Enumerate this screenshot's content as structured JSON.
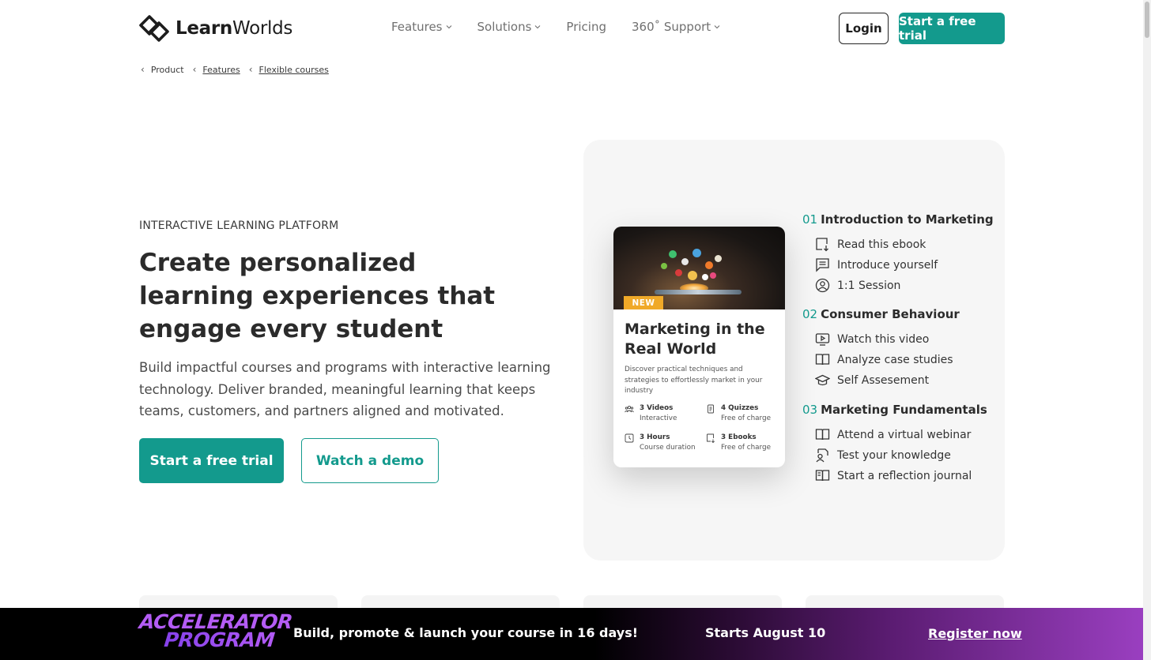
{
  "header": {
    "logo_bold": "Learn",
    "logo_regular": "Worlds",
    "nav": [
      {
        "label": "Features",
        "has_dropdown": true
      },
      {
        "label": "Solutions",
        "has_dropdown": true
      },
      {
        "label": "Pricing",
        "has_dropdown": false
      },
      {
        "label": "360˚ Support",
        "has_dropdown": true
      }
    ],
    "login_label": "Login",
    "trial_label": "Start a free trial"
  },
  "breadcrumb": [
    "Product",
    "Features",
    "Flexible courses"
  ],
  "hero": {
    "eyebrow": "INTERACTIVE LEARNING PLATFORM",
    "title": "Create personalized learning experiences that engage every student",
    "description": "Build impactful courses and programs with interactive learning technology. Deliver branded, meaningful learning that keeps teams, customers, and partners aligned and motivated.",
    "primary_cta": "Start a free trial",
    "secondary_cta": "Watch a demo"
  },
  "course_card": {
    "badge": "NEW",
    "title": "Marketing in the Real World",
    "description": "Discover practical techniques and strategies to effortlessly market in your industry",
    "stats": [
      {
        "title": "3 Videos",
        "sub": "Interactive",
        "icon": "video-group-icon"
      },
      {
        "title": "4 Quizzes",
        "sub": "Free of charge",
        "icon": "quiz-icon"
      },
      {
        "title": "3 Hours",
        "sub": "Course duration",
        "icon": "clock-icon"
      },
      {
        "title": "3 Ebooks",
        "sub": "Free of charge",
        "icon": "ebook-icon"
      }
    ]
  },
  "modules": [
    {
      "num": "01",
      "title": "Introduction to Marketing",
      "lessons": [
        {
          "label": "Read this ebook",
          "icon": "ebook-download-icon"
        },
        {
          "label": "Introduce yourself",
          "icon": "chat-icon"
        },
        {
          "label": "1:1 Session",
          "icon": "user-circle-icon"
        }
      ]
    },
    {
      "num": "02",
      "title": "Consumer Behaviour",
      "lessons": [
        {
          "label": "Watch this video",
          "icon": "video-play-icon"
        },
        {
          "label": "Analyze case studies",
          "icon": "open-book-icon"
        },
        {
          "label": "Self Assesement",
          "icon": "graduation-cap-icon"
        }
      ]
    },
    {
      "num": "03",
      "title": "Marketing Fundamentals",
      "lessons": [
        {
          "label": "Attend a virtual webinar",
          "icon": "open-book-icon"
        },
        {
          "label": "Test your knowledge",
          "icon": "quiz-user-icon"
        },
        {
          "label": "Start a reflection journal",
          "icon": "journal-icon"
        }
      ]
    }
  ],
  "banner": {
    "logo_line1": "ACCELERATOR",
    "logo_line2": "PROGRAM",
    "text": "Build, promote & launch your course in 16 days!",
    "date": "Starts August 10",
    "link": "Register now"
  },
  "colors": {
    "brand_teal": "#139a8d",
    "badge_orange": "#f0a928",
    "banner_purple": "#9a3fc0"
  }
}
